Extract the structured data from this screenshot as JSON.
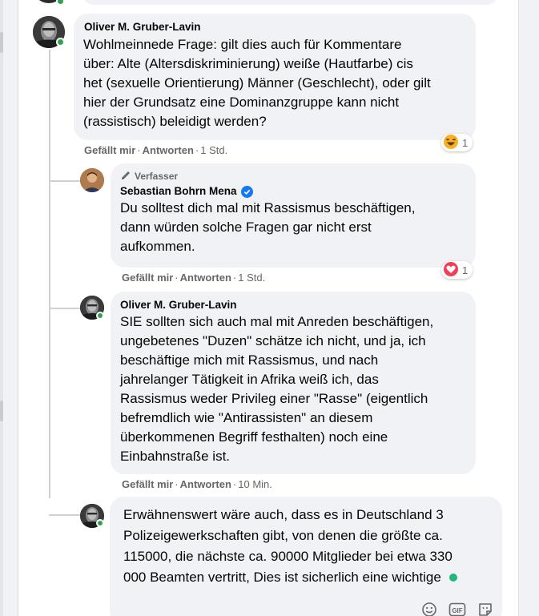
{
  "comments": [
    {
      "author": "Oliver M. Gruber-Lavin",
      "text": "Wohlmeinnede Frage: gilt dies auch für Kommentare über: Alte (Altersdiskriminierung) weiße (Hautfarbe) cis het (sexuelle Orientierung) Männer (Geschlecht), oder gilt hier der Grundsatz eine Dominanzgruppe kann nicht (rassistisch) beleidigt werden?",
      "lines": [
        "Wohlmeinnede Frage: gilt dies auch für Kommentare",
        "über: Alte (Altersdiskriminierung) weiße (Hautfarbe) cis",
        "het (sexuelle Orientierung) Männer (Geschlecht), oder gilt",
        "hier der Grundsatz eine Dominanzgruppe kann nicht",
        "(rassistisch) beleidigt werden?"
      ],
      "like_label": "Gefällt mir",
      "reply_label": "Antworten",
      "time": "1 Std.",
      "reaction": {
        "icon": "haha-icon",
        "count": "1"
      }
    },
    {
      "badge": "Verfasser",
      "author": "Sebastian Bohrn Mena",
      "verified": true,
      "lines": [
        "Du solltest dich mal mit Rassismus beschäftigen,",
        "dann würden solche Fragen gar nicht erst",
        "aufkommen."
      ],
      "like_label": "Gefällt mir",
      "reply_label": "Antworten",
      "time": "1 Std.",
      "reaction": {
        "icon": "love-icon",
        "count": "1"
      }
    },
    {
      "author": "Oliver M. Gruber-Lavin",
      "lines": [
        "SIE sollten sich auch mal mit Anreden beschäftigen,",
        "ungebetenes \"Duzen\" schätze ich nicht, und ja, ich",
        "beschäftige mich mit Rassismus, und nach",
        "jahrelanger Tätigkeit in Afrika weiß ich, das",
        "Rassismus weder Privileg einer \"Rasse\" (eigentlich",
        "befremdlich wie \"Antirassisten\" an diesem",
        "überkommenen Begriff festhalten) noch eine",
        "Einbahnstraße ist."
      ],
      "like_label": "Gefällt mir",
      "reply_label": "Antworten",
      "time": "10 Min."
    }
  ],
  "reply_draft": {
    "lines": [
      "Erwähnenswert wäre auch, dass es in Deutschland 3",
      "Polizeigewerkschaften gibt, von denen die größte ca.",
      "115000, die nächste ca. 90000 Mitglieder bei etwa 330",
      "000 Beamten vertritt, Dies ist sicherlich eine wichtige"
    ],
    "icons": [
      "emoji-icon",
      "gif-icon",
      "sticker-icon"
    ]
  },
  "colors": {
    "bubble": "#f0f2f5",
    "secondary_text": "#65676b",
    "online": "#31a24c",
    "verified": "#1877f2",
    "love": "#f33e58",
    "haha": "#f7b125"
  }
}
